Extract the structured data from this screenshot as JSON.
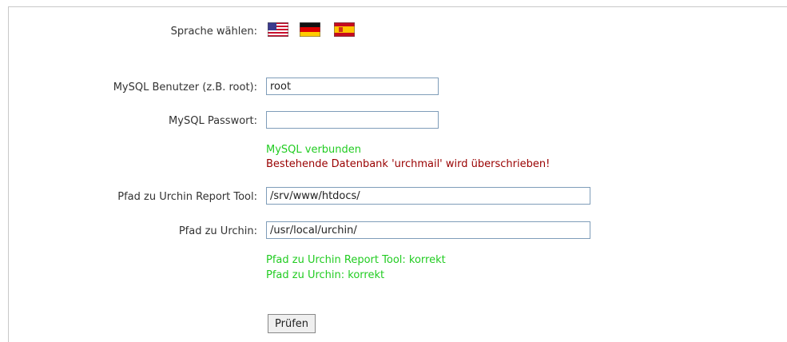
{
  "language": {
    "label": "Sprache wählen:",
    "flags": [
      {
        "icon": "us-flag-icon",
        "lang": "en"
      },
      {
        "icon": "de-flag-icon",
        "lang": "de"
      },
      {
        "icon": "es-flag-icon",
        "lang": "es"
      }
    ]
  },
  "mysql_user": {
    "label": "MySQL Benutzer (z.B. root):",
    "value": "root"
  },
  "mysql_password": {
    "label": "MySQL Passwort:",
    "value": ""
  },
  "mysql_status": {
    "connected": "MySQL verbunden",
    "overwrite_warning": "Bestehende Datenbank 'urchmail' wird überschrieben!"
  },
  "report_tool_path": {
    "label": "Pfad zu Urchin Report Tool:",
    "value": "/srv/www/htdocs/"
  },
  "urchin_path": {
    "label": "Pfad zu Urchin:",
    "value": "/usr/local/urchin/"
  },
  "path_status": {
    "report_tool_ok": "Pfad zu Urchin Report Tool: korrekt",
    "urchin_ok": "Pfad zu Urchin: korrekt"
  },
  "check_button": "Prüfen",
  "colors": {
    "ok": "#22cc22",
    "warning": "#990000",
    "border": "#7f9db9"
  }
}
